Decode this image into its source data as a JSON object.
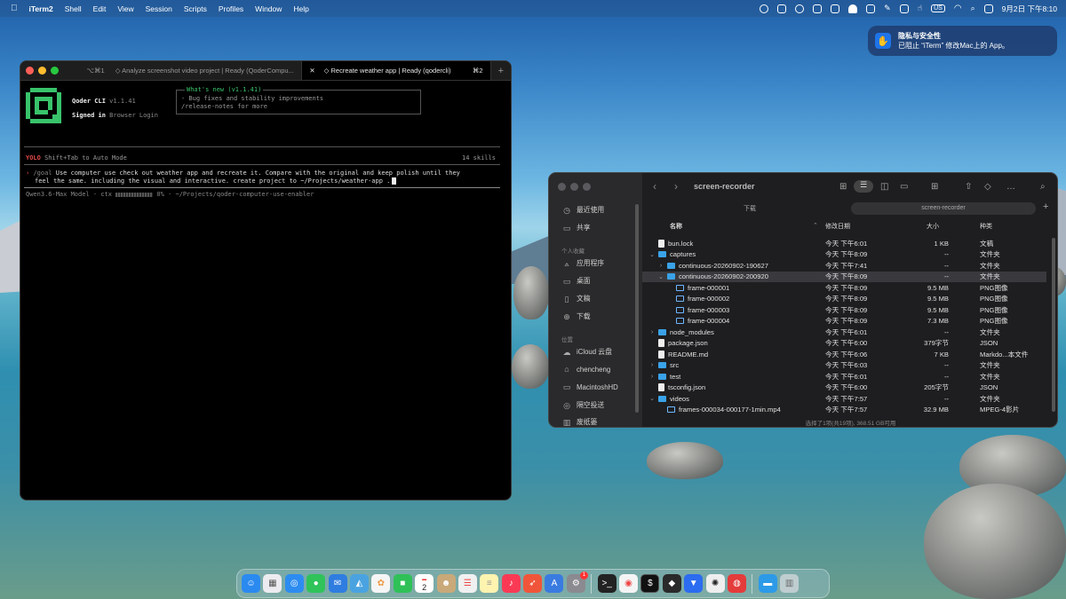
{
  "menubar": {
    "app": "iTerm2",
    "items": [
      "Shell",
      "Edit",
      "View",
      "Session",
      "Scripts",
      "Profiles",
      "Window",
      "Help"
    ],
    "input_badge": "US",
    "clock": "9月2日 下午8:10"
  },
  "notification": {
    "title": "隐私与安全性",
    "body": "已阻止 “iTerm” 修改Mac上的 App。"
  },
  "terminal": {
    "tabs": [
      {
        "prefix": "⌥⌘1",
        "label": "◇ Analyze screenshot video project | Ready (QoderCompu...",
        "shortcut": "⌘1"
      },
      {
        "label": "◇ Recreate weather app | Ready (qodercli)",
        "shortcut": "⌘2"
      }
    ],
    "app_name": "Qoder CLI",
    "version": "v1.1.41",
    "signed_in_label": "Signed in",
    "signed_in_method": "Browser Login",
    "whats_new_title": "What's new (v1.1.41)",
    "whats_new_line1": "- Bug fixes and stability improvements",
    "whats_new_line2": "/release-notes for more",
    "mode_badge": "YOLO",
    "mode_hint": "Shift+Tab to Auto Mode",
    "skills": "14 skills",
    "prompt_marker": "›",
    "prompt_cmd": "/goal",
    "prompt_line1": "Use computer use check out weather app and recreate it. Compare with the original and keep polish until they",
    "prompt_line2": "feel the same. including the visual and interactive. create project to ~/Projects/weather-app .",
    "status_model": "Qwen3.6-Max Model",
    "status_ctx": "ctx",
    "status_pct": "0%",
    "status_path": "~/Projects/qoder-computer-use-enabler"
  },
  "finder": {
    "title": "screen-recorder",
    "path_left": "下载",
    "path_right": "screen-recorder",
    "sidebar": {
      "recents": "最近使用",
      "shared": "共享",
      "fav_header": "个人收藏",
      "apps": "应用程序",
      "desktop": "桌面",
      "docs": "文稿",
      "downloads": "下载",
      "loc_header": "位置",
      "icloud": "iCloud 云盘",
      "user": "chencheng",
      "disk": "MacintoshHD",
      "airdrop": "隔空投送",
      "trash": "废纸篓"
    },
    "columns": {
      "name": "名称",
      "date": "修改日期",
      "size": "大小",
      "kind": "种类"
    },
    "rows": [
      {
        "name": "bun.lock",
        "date": "今天 下午6:01",
        "size": "1 KB",
        "kind": "文稿",
        "type": "doc",
        "indent": 0,
        "chev": ""
      },
      {
        "name": "captures",
        "date": "今天 下午8:09",
        "size": "--",
        "kind": "文件夹",
        "type": "folder",
        "indent": 0,
        "chev": "⌄"
      },
      {
        "name": "continuous-20260902-190627",
        "date": "今天 下午7:41",
        "size": "--",
        "kind": "文件夹",
        "type": "folder",
        "indent": 1,
        "chev": "›"
      },
      {
        "name": "continuous-20260902-200920",
        "date": "今天 下午8:09",
        "size": "--",
        "kind": "文件夹",
        "type": "folder",
        "indent": 1,
        "chev": "⌄"
      },
      {
        "name": "frame-000001",
        "date": "今天 下午8:09",
        "size": "9.5 MB",
        "kind": "PNG图像",
        "type": "img",
        "indent": 2,
        "chev": ""
      },
      {
        "name": "frame-000002",
        "date": "今天 下午8:09",
        "size": "9.5 MB",
        "kind": "PNG图像",
        "type": "img",
        "indent": 2,
        "chev": ""
      },
      {
        "name": "frame-000003",
        "date": "今天 下午8:09",
        "size": "9.5 MB",
        "kind": "PNG图像",
        "type": "img",
        "indent": 2,
        "chev": ""
      },
      {
        "name": "frame-000004",
        "date": "今天 下午8:09",
        "size": "7.3 MB",
        "kind": "PNG图像",
        "type": "img",
        "indent": 2,
        "chev": ""
      },
      {
        "name": "node_modules",
        "date": "今天 下午6:01",
        "size": "--",
        "kind": "文件夹",
        "type": "folder",
        "indent": 0,
        "chev": "›"
      },
      {
        "name": "package.json",
        "date": "今天 下午6:00",
        "size": "379字节",
        "kind": "JSON",
        "type": "doc",
        "indent": 0,
        "chev": ""
      },
      {
        "name": "README.md",
        "date": "今天 下午6:06",
        "size": "7 KB",
        "kind": "Markdo...本文件",
        "type": "doc",
        "indent": 0,
        "chev": ""
      },
      {
        "name": "src",
        "date": "今天 下午6:03",
        "size": "--",
        "kind": "文件夹",
        "type": "folder",
        "indent": 0,
        "chev": "›"
      },
      {
        "name": "test",
        "date": "今天 下午6:01",
        "size": "--",
        "kind": "文件夹",
        "type": "folder",
        "indent": 0,
        "chev": "›"
      },
      {
        "name": "tsconfig.json",
        "date": "今天 下午6:00",
        "size": "205字节",
        "kind": "JSON",
        "type": "doc",
        "indent": 0,
        "chev": ""
      },
      {
        "name": "videos",
        "date": "今天 下午7:57",
        "size": "--",
        "kind": "文件夹",
        "type": "folder",
        "indent": 0,
        "chev": "⌄"
      },
      {
        "name": "frames-000034-000177-1min.mp4",
        "date": "今天 下午7:57",
        "size": "32.9 MB",
        "kind": "MPEG-4影片",
        "type": "img",
        "indent": 1,
        "chev": ""
      }
    ],
    "status": "选择了1项(共19项), 368.51 GB可用"
  },
  "dock": {
    "calendar_day": "2",
    "badge": "1"
  }
}
